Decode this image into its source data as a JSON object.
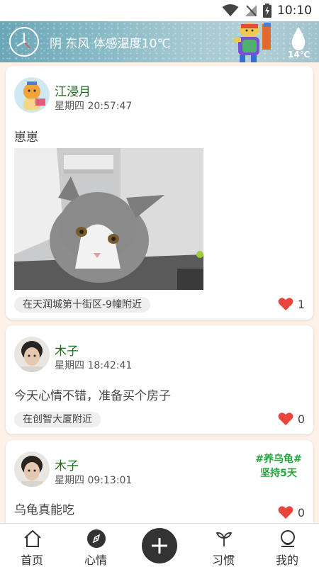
{
  "status_bar": {
    "time": "10:10"
  },
  "weather": {
    "description": "阴 东风 体感温度10℃",
    "temperature": "14℃"
  },
  "posts": [
    {
      "username": "江浸月",
      "timestamp": "星期四 20:57:47",
      "text": "崽崽",
      "location": "在天润城第十街区-9幢附近",
      "likes": "1",
      "has_photo": true
    },
    {
      "username": "木子",
      "timestamp": "星期四 18:42:41",
      "text": "今天心情不错，准备买个房子",
      "location": "在创智大厦附近",
      "likes": "0"
    },
    {
      "username": "木子",
      "timestamp": "星期四 09:13:01",
      "text": "乌龟真能吃",
      "likes": "0",
      "habit_tag": {
        "name": "#养乌龟#",
        "streak": "坚持5天"
      }
    }
  ],
  "nav": {
    "items": [
      {
        "label": "首页",
        "icon": "home-icon"
      },
      {
        "label": "心情",
        "icon": "compass-icon"
      },
      {
        "label": "",
        "icon": "add-icon"
      },
      {
        "label": "习惯",
        "icon": "sprout-icon"
      },
      {
        "label": "我的",
        "icon": "profile-icon"
      }
    ]
  },
  "colors": {
    "accent": "#1e6b1e",
    "like": "#e8453c",
    "habit": "#22a83a",
    "background": "#fdf1e8"
  }
}
